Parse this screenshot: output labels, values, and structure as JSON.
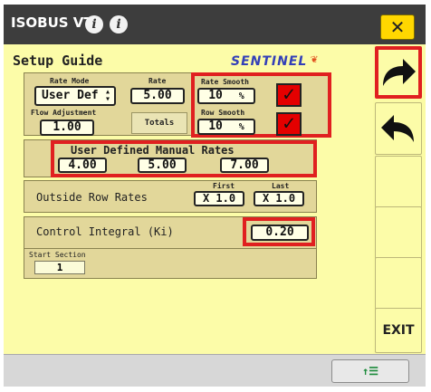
{
  "window": {
    "title": "ISOBUS VT"
  },
  "header": {
    "title": "Setup Guide",
    "logo_text": "SENTINEL",
    "logo_mark": "❦"
  },
  "rate_panel": {
    "rate_mode_label": "Rate Mode",
    "rate_mode_value": "User Def",
    "rate_label": "Rate",
    "rate_value": "5.00",
    "flow_adjustment_label": "Flow Adjustment",
    "flow_adjustment_value": "1.00",
    "totals_label": "Totals",
    "rate_smooth_label": "Rate Smooth",
    "rate_smooth_value": "10",
    "row_smooth_label": "Row Smooth",
    "row_smooth_value": "10",
    "percent_unit": "%",
    "rate_smooth_checked": true,
    "row_smooth_checked": true
  },
  "manual_rates": {
    "title": "User Defined Manual Rates",
    "values": [
      "4.00",
      "5.00",
      "7.00"
    ]
  },
  "outside_rows": {
    "label": "Outside Row Rates",
    "first_label": "First",
    "last_label": "Last",
    "first_value": "X 1.0",
    "last_value": "X 1.0"
  },
  "control_integral": {
    "label": "Control Integral (Ki)",
    "value": "0.20"
  },
  "start_section": {
    "label": "Start Section",
    "value": "1"
  },
  "softkeys": [
    {
      "icon": "arrow-forward-icon"
    },
    {
      "icon": "arrow-back-icon"
    },
    {
      "icon": ""
    },
    {
      "icon": ""
    },
    {
      "icon": ""
    },
    {
      "label": "EXIT"
    }
  ],
  "exit_label": "EXIT",
  "close_label": "✕",
  "bottom_button": {
    "icon": "list-sort-icon",
    "glyph": "↑☰"
  },
  "colors": {
    "background": "#fcfca8",
    "panel": "#e2d79a",
    "highlight": "#e02020",
    "titlebar": "#3d3d3d",
    "close": "#ffd700"
  }
}
